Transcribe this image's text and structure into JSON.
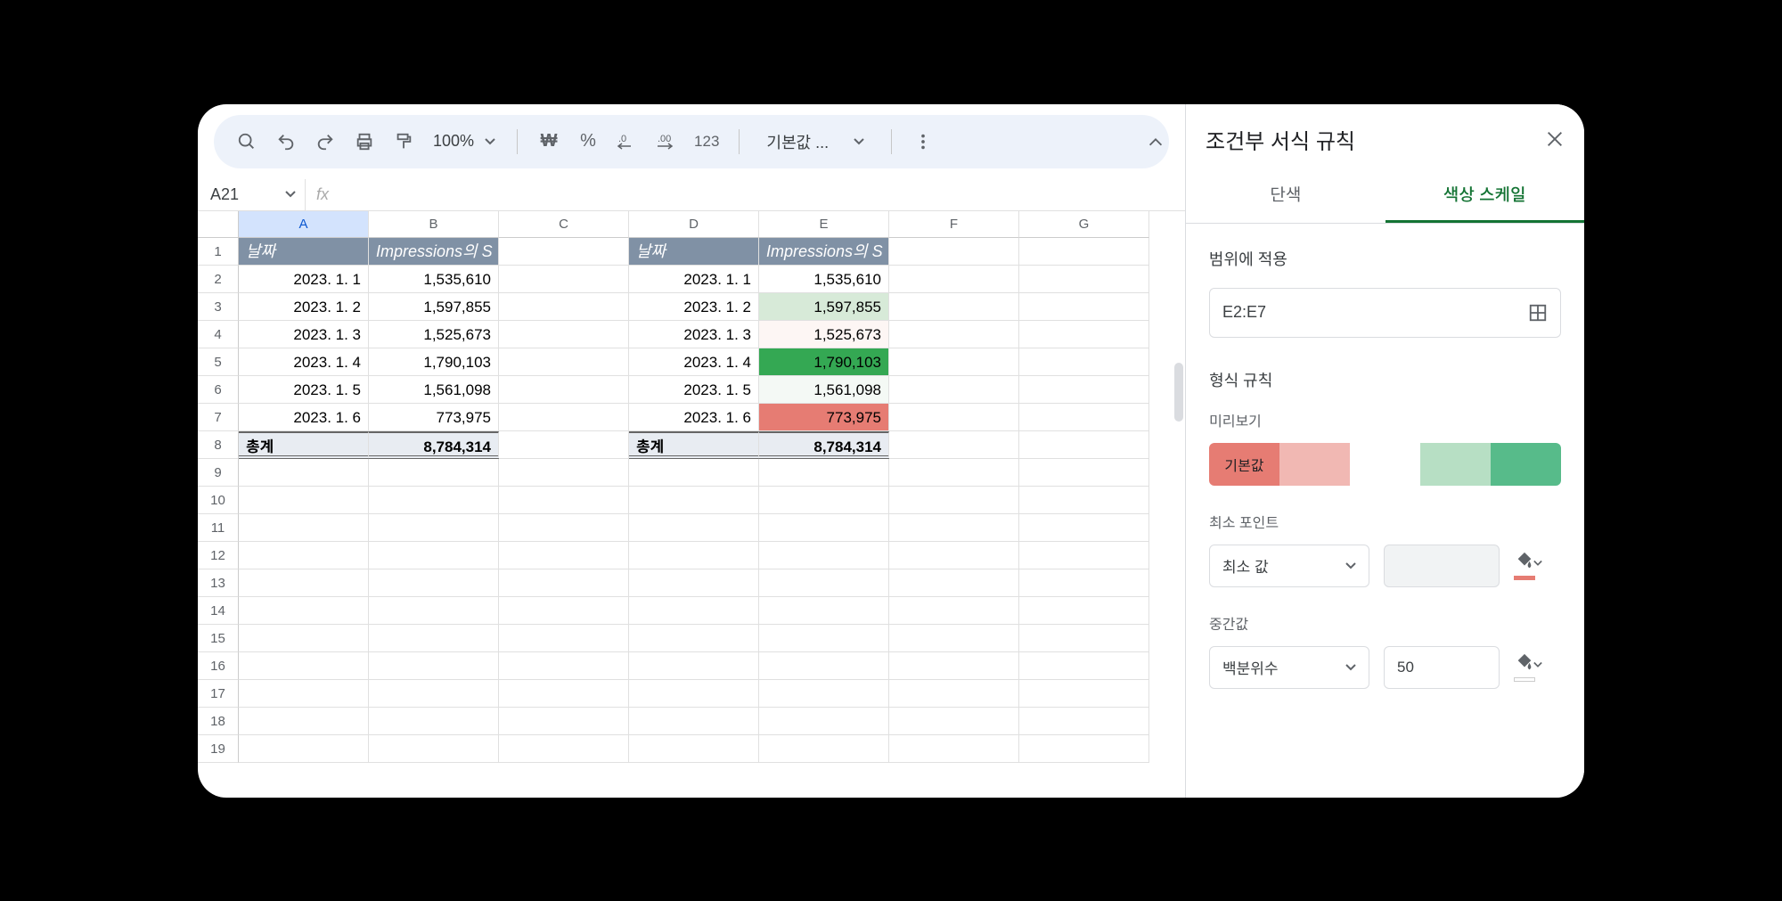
{
  "toolbar": {
    "zoom": "100%",
    "currency_symbol": "₩",
    "percent_symbol": "%",
    "number_format": "123",
    "font_default": "기본값 ..."
  },
  "namebox": {
    "cell": "A21",
    "fx_symbol": "fx"
  },
  "columns": [
    "A",
    "B",
    "C",
    "D",
    "E",
    "F",
    "G"
  ],
  "row_numbers": [
    "1",
    "2",
    "3",
    "4",
    "5",
    "6",
    "7",
    "8",
    "9",
    "10",
    "11",
    "12",
    "13",
    "14",
    "15",
    "16",
    "17",
    "18",
    "19"
  ],
  "table1": {
    "header_date": "날짜",
    "header_metric": "Impressions의 S",
    "rows": [
      {
        "date": "2023. 1. 1",
        "value": "1,535,610"
      },
      {
        "date": "2023. 1. 2",
        "value": "1,597,855"
      },
      {
        "date": "2023. 1. 3",
        "value": "1,525,673"
      },
      {
        "date": "2023. 1. 4",
        "value": "1,790,103"
      },
      {
        "date": "2023. 1. 5",
        "value": "1,561,098"
      },
      {
        "date": "2023. 1. 6",
        "value": "773,975"
      }
    ],
    "total_label": "총계",
    "total_value": "8,784,314"
  },
  "table2": {
    "header_date": "날짜",
    "header_metric": "Impressions의 S",
    "rows": [
      {
        "date": "2023. 1. 1",
        "value": "1,535,610",
        "bg": "#ffffff"
      },
      {
        "date": "2023. 1. 2",
        "value": "1,597,855",
        "bg": "#d7ead8"
      },
      {
        "date": "2023. 1. 3",
        "value": "1,525,673",
        "bg": "#fdf6f4"
      },
      {
        "date": "2023. 1. 4",
        "value": "1,790,103",
        "bg": "#34a853"
      },
      {
        "date": "2023. 1. 5",
        "value": "1,561,098",
        "bg": "#f4f9f5"
      },
      {
        "date": "2023. 1. 6",
        "value": "773,975",
        "bg": "#e67c73"
      }
    ],
    "total_label": "총계",
    "total_value": "8,784,314"
  },
  "sidebar": {
    "title": "조건부 서식 규칙",
    "tab_single": "단색",
    "tab_scale": "색상 스케일",
    "apply_range_label": "범위에 적용",
    "range_value": "E2:E7",
    "format_rules_label": "형식 규칙",
    "preview_label": "미리보기",
    "preview_text": "기본값",
    "preview_colors": [
      "#e67c73",
      "#f1b8b3",
      "#ffffff",
      "#b7dfc4",
      "#57bb8a"
    ],
    "min_point_label": "최소 포인트",
    "min_select": "최소 값",
    "min_color": "#e67c73",
    "mid_point_label": "중간값",
    "mid_select": "백분위수",
    "mid_value": "50",
    "mid_color": "#ffffff"
  }
}
